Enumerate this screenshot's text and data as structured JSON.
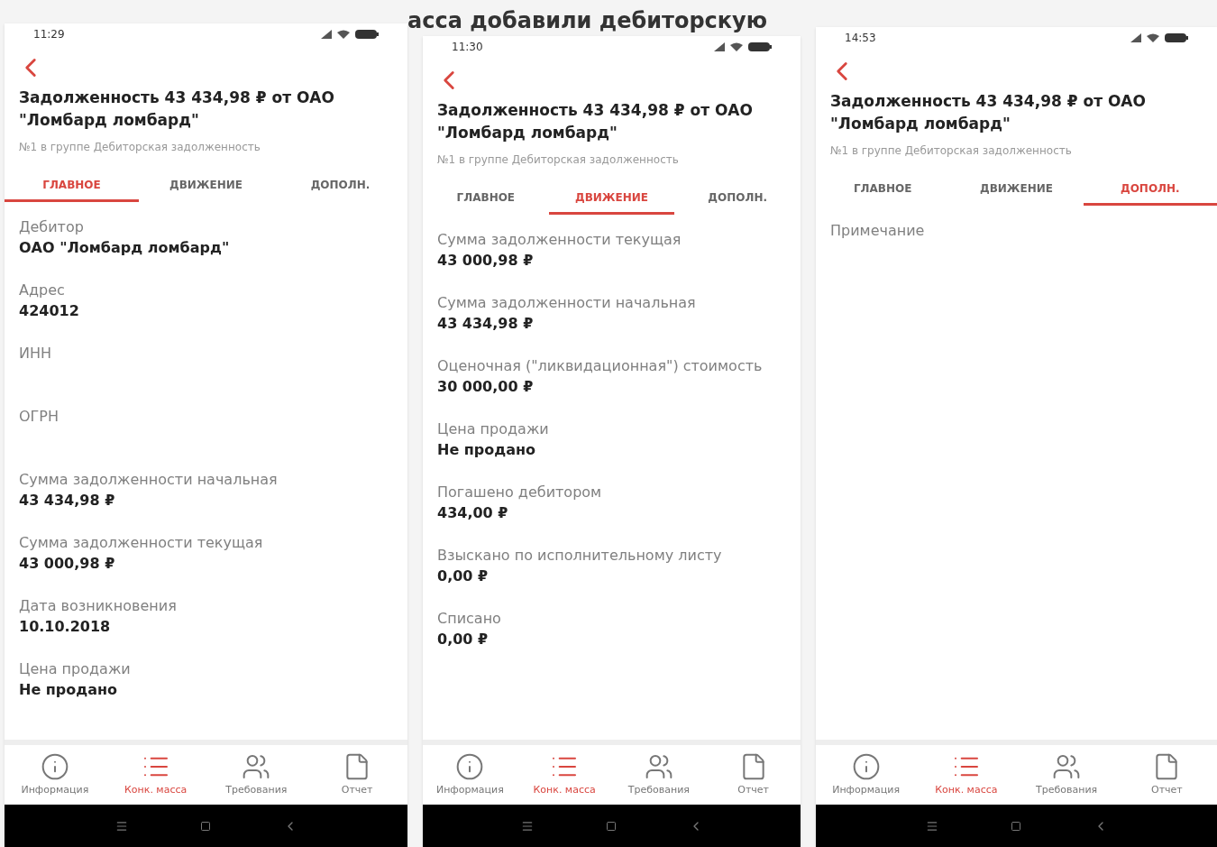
{
  "background_heading": "асса добавили дебиторскую",
  "phones": [
    {
      "time": "11:29",
      "title": "Задолженность 43 434,98 ₽ от ОАО \"Ломбард ломбард\"",
      "subtitle": "№1 в группе Дебиторская задолженность",
      "tabs": [
        {
          "label": "ГЛАВНОЕ",
          "selected": true
        },
        {
          "label": "ДВИЖЕНИЕ",
          "selected": false
        },
        {
          "label": "ДОПОЛН.",
          "selected": false
        }
      ],
      "fields": [
        {
          "label": "Дебитор",
          "value": "ОАО \"Ломбард ломбард\""
        },
        {
          "label": "Адрес",
          "value": "424012"
        },
        {
          "label": "ИНН"
        },
        {
          "label": "ОГРН"
        },
        {
          "label": "Сумма задолженности начальная",
          "value": "43 434,98 ₽"
        },
        {
          "label": "Сумма задолженности текущая",
          "value": "43 000,98 ₽"
        },
        {
          "label": "Дата возникновения",
          "value": "10.10.2018"
        },
        {
          "label": "Цена продажи",
          "value": "Не продано"
        }
      ],
      "nav": [
        {
          "kind": "info",
          "label": "Информация",
          "selected": false
        },
        {
          "kind": "list",
          "label": "Конк. масса",
          "selected": true
        },
        {
          "kind": "people",
          "label": "Требования",
          "selected": false
        },
        {
          "kind": "file",
          "label": "Отчет",
          "selected": false
        }
      ]
    },
    {
      "time": "11:30",
      "title": "Задолженность 43 434,98 ₽ от ОАО \"Ломбард ломбард\"",
      "subtitle": "№1 в группе Дебиторская задолженность",
      "tabs": [
        {
          "label": "ГЛАВНОЕ",
          "selected": false
        },
        {
          "label": "ДВИЖЕНИЕ",
          "selected": true
        },
        {
          "label": "ДОПОЛН.",
          "selected": false
        }
      ],
      "fields": [
        {
          "label": "Сумма задолженности текущая",
          "value": "43 000,98 ₽"
        },
        {
          "label": "Сумма задолженности начальная",
          "value": "43 434,98 ₽"
        },
        {
          "label": "Оценочная (\"ликвидационная\") стоимость",
          "value": "30 000,00 ₽"
        },
        {
          "label": "Цена продажи",
          "value": "Не продано"
        },
        {
          "label": "Погашено дебитором",
          "value": "434,00 ₽"
        },
        {
          "label": "Взыскано по исполнительному листу",
          "value": "0,00 ₽"
        },
        {
          "label": "Списано",
          "value": "0,00 ₽"
        }
      ],
      "nav": [
        {
          "kind": "info",
          "label": "Информация",
          "selected": false
        },
        {
          "kind": "list",
          "label": "Конк. масса",
          "selected": true
        },
        {
          "kind": "people",
          "label": "Требования",
          "selected": false
        },
        {
          "kind": "file",
          "label": "Отчет",
          "selected": false
        }
      ]
    },
    {
      "time": "14:53",
      "title": "Задолженность 43 434,98 ₽ от ОАО \"Ломбард ломбард\"",
      "subtitle": "№1 в группе Дебиторская задолженность",
      "tabs": [
        {
          "label": "ГЛАВНОЕ",
          "selected": false
        },
        {
          "label": "ДВИЖЕНИЕ",
          "selected": false
        },
        {
          "label": "ДОПОЛН.",
          "selected": true
        }
      ],
      "fields": [
        {
          "label": "Примечание"
        }
      ],
      "nav": [
        {
          "kind": "info",
          "label": "Информация",
          "selected": false
        },
        {
          "kind": "list",
          "label": "Конк. масса",
          "selected": true
        },
        {
          "kind": "people",
          "label": "Требования",
          "selected": false
        },
        {
          "kind": "file",
          "label": "Отчет",
          "selected": false
        }
      ]
    }
  ]
}
